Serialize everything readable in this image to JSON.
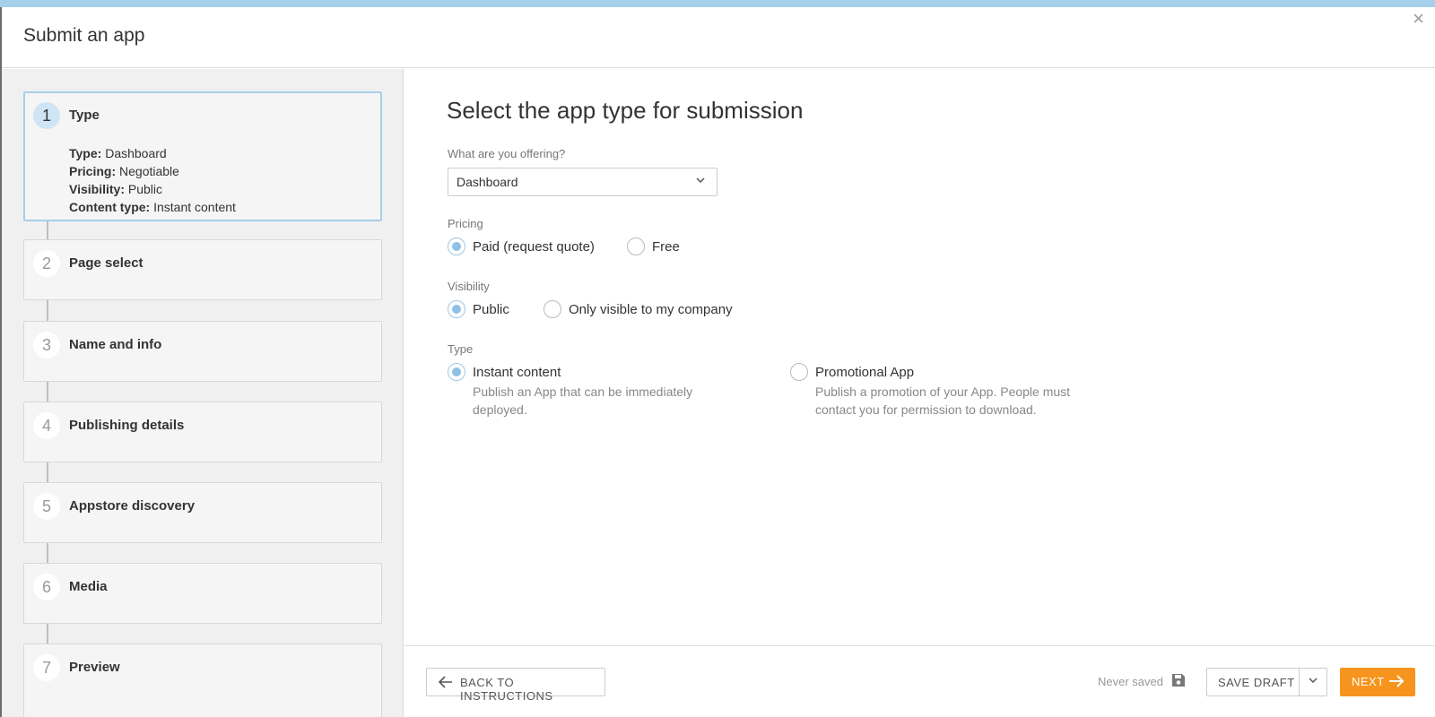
{
  "header": {
    "title": "Submit an app",
    "close_icon": "×"
  },
  "sidebar": {
    "steps": [
      {
        "num": "1",
        "label": "Type"
      },
      {
        "num": "2",
        "label": "Page select"
      },
      {
        "num": "3",
        "label": "Name and info"
      },
      {
        "num": "4",
        "label": "Publishing details"
      },
      {
        "num": "5",
        "label": "Appstore discovery"
      },
      {
        "num": "6",
        "label": "Media"
      },
      {
        "num": "7",
        "label": "Preview"
      }
    ],
    "summary": [
      {
        "key": "Type:",
        "value": " Dashboard"
      },
      {
        "key": "Pricing:",
        "value": " Negotiable"
      },
      {
        "key": "Visibility:",
        "value": " Public"
      },
      {
        "key": "Content type:",
        "value": " Instant content"
      }
    ]
  },
  "main": {
    "heading": "Select the app type for submission",
    "offering": {
      "label": "What are you offering?",
      "value": "Dashboard"
    },
    "pricing": {
      "label": "Pricing",
      "options": [
        "Paid (request quote)",
        "Free"
      ],
      "selected": "Paid (request quote)"
    },
    "visibility": {
      "label": "Visibility",
      "options": [
        "Public",
        "Only visible to my company"
      ],
      "selected": "Public"
    },
    "type": {
      "label": "Type",
      "options": [
        {
          "label": "Instant content",
          "desc_line1": "Publish an App that can be immediately",
          "desc_line2": "deployed."
        },
        {
          "label": "Promotional App",
          "desc_line1": "Publish a promotion of your App. People must",
          "desc_line2": "contact you for permission to download."
        }
      ],
      "selected": "Instant content"
    }
  },
  "footer": {
    "back_label": "BACK TO INSTRUCTIONS",
    "save_status": "Never saved",
    "save_draft_label": "SAVE DRAFT",
    "next_label": "NEXT"
  },
  "colors": {
    "accent_blue": "#a6cfe9",
    "next_orange": "#f7941d"
  }
}
